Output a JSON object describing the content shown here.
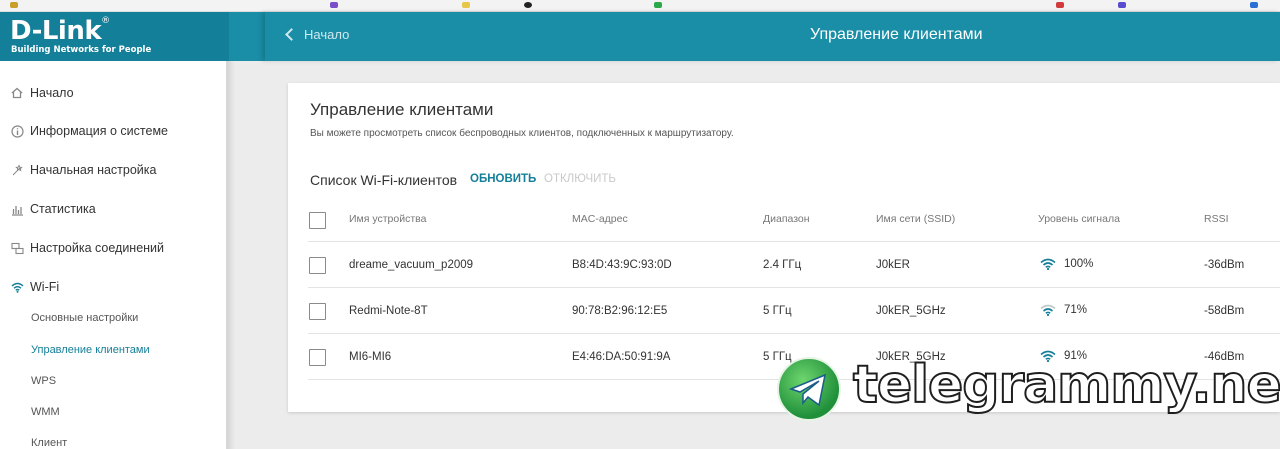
{
  "header": {
    "logo_text": "D-Link",
    "logo_tagline": "Building Networks for People",
    "back_label": "Начало",
    "page_title": "Управление клиентами"
  },
  "sidebar": {
    "items": [
      {
        "label": "Начало",
        "icon": "home-icon"
      },
      {
        "label": "Информация о системе",
        "icon": "info-icon"
      },
      {
        "label": "Начальная настройка",
        "icon": "wizard-icon"
      },
      {
        "label": "Статистика",
        "icon": "stats-icon"
      },
      {
        "label": "Настройка соединений",
        "icon": "connections-icon"
      },
      {
        "label": "Wi-Fi",
        "icon": "wifi-icon"
      }
    ],
    "subitems": [
      {
        "label": "Основные настройки",
        "active": false
      },
      {
        "label": "Управление клиентами",
        "active": true
      },
      {
        "label": "WPS",
        "active": false
      },
      {
        "label": "WMM",
        "active": false
      },
      {
        "label": "Клиент",
        "active": false
      }
    ]
  },
  "main": {
    "title": "Управление клиентами",
    "description": "Вы можете просмотреть список беспроводных клиентов, подключенных к маршрутизатору.",
    "list_title": "Список Wi-Fi-клиентов",
    "refresh_label": "ОБНОВИТЬ",
    "disconnect_label": "ОТКЛЮЧИТЬ",
    "columns": [
      "Имя устройства",
      "MAC-адрес",
      "Диапазон",
      "Имя сети (SSID)",
      "Уровень сигнала",
      "RSSI"
    ],
    "rows": [
      {
        "name": "dreame_vacuum_p2009",
        "mac": "B8:4D:43:9C:93:0D",
        "band": "2.4 ГГц",
        "ssid": "J0kER",
        "signal": "100%",
        "rssi": "-36dBm"
      },
      {
        "name": "Redmi-Note-8T",
        "mac": "90:78:B2:96:12:E5",
        "band": "5 ГГц",
        "ssid": "J0kER_5GHz",
        "signal": "71%",
        "rssi": "-58dBm"
      },
      {
        "name": "MI6-MI6",
        "mac": "E4:46:DA:50:91:9A",
        "band": "5 ГГц",
        "ssid": "J0kER_5GHz",
        "signal": "91%",
        "rssi": "-46dBm"
      }
    ]
  },
  "watermark": {
    "text": "telegrammy.net"
  },
  "colors": {
    "brand": "#147f98",
    "accent": "#1a8ea6",
    "disabled": "#c9c9c9"
  }
}
